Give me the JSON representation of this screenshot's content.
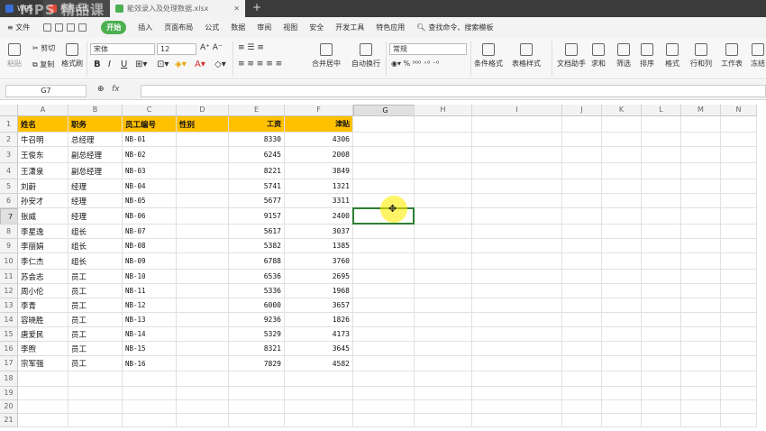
{
  "titlebar": {
    "tabs": [
      {
        "label": "WPS",
        "color": "#3a6fd8"
      },
      {
        "label": "稻壳商城",
        "color": "#e04a3a"
      },
      {
        "label": "能效录入及处理数据.xlsx",
        "color": "#4caf50"
      }
    ],
    "watermark": "MPS 精品课"
  },
  "menubar": {
    "file": "≡ 文件",
    "items": [
      "开始",
      "插入",
      "页面布局",
      "公式",
      "数据",
      "审阅",
      "视图",
      "安全",
      "开发工具",
      "特色应用"
    ],
    "active": "开始",
    "search": "查找命令、搜索模板"
  },
  "ribbon": {
    "paste": "粘贴",
    "cut": "剪切",
    "copy": "复制",
    "format_painter": "格式刷",
    "font_name": "宋体",
    "font_size": "12",
    "merge": "合并居中",
    "wrap": "自动换行",
    "number_format": "常规",
    "cond_format": "条件格式",
    "table_style": "表格样式",
    "doc_helper": "文档助手",
    "sum": "求和",
    "filter": "筛选",
    "sort": "排序",
    "format": "格式",
    "rowcol": "行和列",
    "sheet": "工作表",
    "freeze": "冻结"
  },
  "formulabar": {
    "namebox": "G7",
    "fx": "fx",
    "value": ""
  },
  "grid": {
    "columns": [
      "A",
      "B",
      "C",
      "D",
      "E",
      "F",
      "G",
      "H",
      "I",
      "J",
      "K",
      "L",
      "M",
      "N"
    ],
    "selected_cell": {
      "col": "G",
      "row": 7
    },
    "header_row": [
      "姓名",
      "职务",
      "员工编号",
      "性别",
      "工资",
      "津贴"
    ],
    "rows": [
      [
        "牛召明",
        "总经理",
        "NB-01",
        "",
        "8330",
        "4306"
      ],
      [
        "王俊东",
        "副总经理",
        "NB-02",
        "",
        "6245",
        "2008"
      ],
      [
        "王潇泉",
        "副总经理",
        "NB-03",
        "",
        "8221",
        "3849"
      ],
      [
        "刘蔚",
        "经理",
        "NB-04",
        "",
        "5741",
        "1321"
      ],
      [
        "孙安才",
        "经理",
        "NB-05",
        "",
        "5677",
        "3311"
      ],
      [
        "张威",
        "经理",
        "NB-06",
        "",
        "9157",
        "2400"
      ],
      [
        "李星逸",
        "组长",
        "NB-07",
        "",
        "5617",
        "3037"
      ],
      [
        "李丽娟",
        "组长",
        "NB-08",
        "",
        "5382",
        "1385"
      ],
      [
        "李仁杰",
        "组长",
        "NB-09",
        "",
        "6788",
        "3760"
      ],
      [
        "苏会志",
        "员工",
        "NB-10",
        "",
        "6536",
        "2695"
      ],
      [
        "周小伦",
        "员工",
        "NB-11",
        "",
        "5336",
        "1968"
      ],
      [
        "李青",
        "员工",
        "NB-12",
        "",
        "6000",
        "3657"
      ],
      [
        "容晓胜",
        "员工",
        "NB-13",
        "",
        "9236",
        "1826"
      ],
      [
        "唐爱民",
        "员工",
        "NB-14",
        "",
        "5329",
        "4173"
      ],
      [
        "李煦",
        "员工",
        "NB-15",
        "",
        "8321",
        "3645"
      ],
      [
        "宗军强",
        "员工",
        "NB-16",
        "",
        "7829",
        "4582"
      ]
    ],
    "row_numbers": [
      "1",
      "2",
      "3",
      "4",
      "5",
      "6",
      "7",
      "8",
      "9",
      "10",
      "11",
      "12",
      "13",
      "14",
      "15",
      "16",
      "17",
      "18",
      "19",
      "20",
      "21"
    ]
  },
  "colors": {
    "header_fill": "#ffc000",
    "accent": "#4caf50",
    "selection": "#2e7d32"
  }
}
